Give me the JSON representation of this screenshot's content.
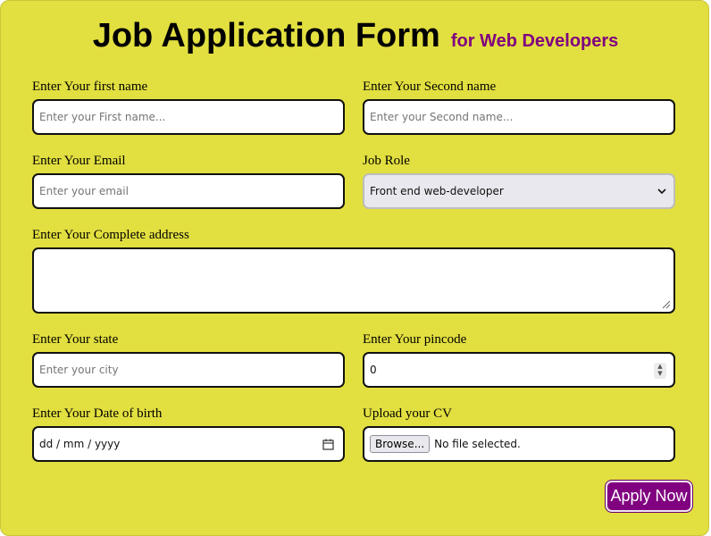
{
  "header": {
    "title": "Job Application Form",
    "subtitle": "for Web Developers"
  },
  "fields": {
    "first_name": {
      "label": "Enter Your first name",
      "placeholder": "Enter your First name..."
    },
    "second_name": {
      "label": "Enter Your Second name",
      "placeholder": "Enter your Second name..."
    },
    "email": {
      "label": "Enter Your Email",
      "placeholder": "Enter your email"
    },
    "job_role": {
      "label": "Job Role",
      "selected": "Front end web-developer"
    },
    "address": {
      "label": "Enter Your Complete address",
      "value": ""
    },
    "state": {
      "label": "Enter Your state",
      "placeholder": "Enter your city"
    },
    "pincode": {
      "label": "Enter Your pincode",
      "value": "0"
    },
    "dob": {
      "label": "Enter Your Date of birth",
      "placeholder": "dd / mm / yyyy"
    },
    "cv": {
      "label": "Upload your CV",
      "button_label": "Browse...",
      "status": "No file selected."
    }
  },
  "submit": {
    "label": "Apply Now"
  },
  "colors": {
    "background": "#e2df40",
    "accent": "#800080",
    "text": "#000000"
  },
  "icons": [
    "chevron-down-icon",
    "resize-handle-icon",
    "spinner-arrows-icon",
    "calendar-icon"
  ]
}
